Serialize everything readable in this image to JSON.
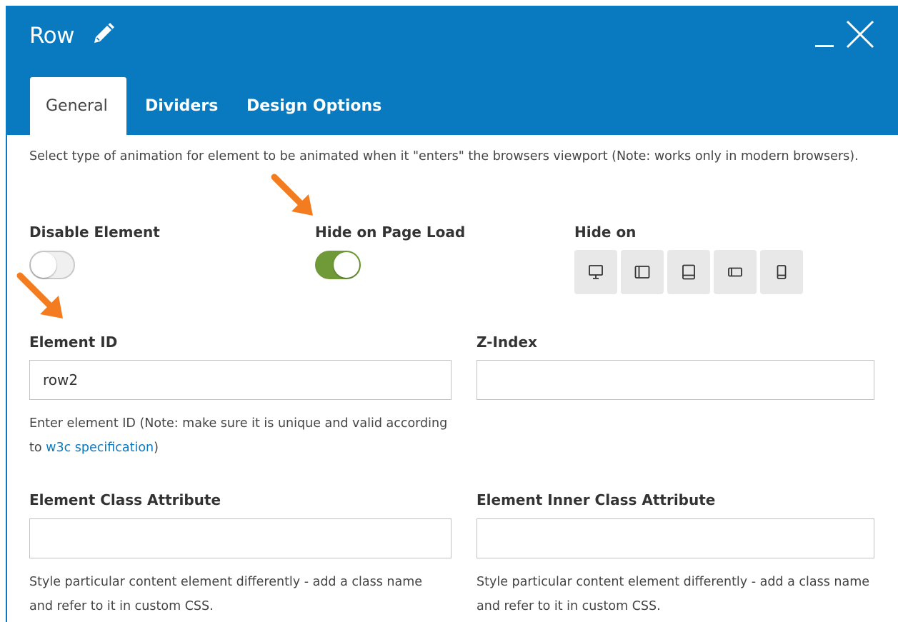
{
  "window": {
    "title": "Row",
    "icons": {
      "edit": "pencil-icon",
      "minimize": "minimize-icon",
      "close": "close-icon"
    },
    "accent_color": "#0a7ac0"
  },
  "tabs": [
    {
      "label": "General",
      "active": true
    },
    {
      "label": "Dividers",
      "active": false
    },
    {
      "label": "Design Options",
      "active": false
    }
  ],
  "description": "Select type of animation for element to be animated when it \"enters\" the browsers viewport (Note: works only in modern browsers).",
  "fields": {
    "disable_element": {
      "label": "Disable Element",
      "on": false
    },
    "hide_on_page_load": {
      "label": "Hide on Page Load",
      "on": true
    },
    "hide_on": {
      "label": "Hide on",
      "devices": [
        "desktop-icon",
        "tablet-landscape-icon",
        "tablet-portrait-icon",
        "mobile-landscape-icon",
        "mobile-portrait-icon"
      ]
    },
    "element_id": {
      "label": "Element ID",
      "value": "row2",
      "help_prefix": "Enter element ID (Note: make sure it is unique and valid according to ",
      "help_link": "w3c specification",
      "help_suffix": ")"
    },
    "z_index": {
      "label": "Z-Index",
      "value": ""
    },
    "element_class": {
      "label": "Element Class Attribute",
      "value": "",
      "help": "Style particular content element differently - add a class name and refer to it in custom CSS."
    },
    "element_inner_class": {
      "label": "Element Inner Class Attribute",
      "value": "",
      "help": "Style particular content element differently - add a class name and refer to it in custom CSS."
    }
  },
  "annotations": {
    "arrow_color": "#f47c20"
  }
}
